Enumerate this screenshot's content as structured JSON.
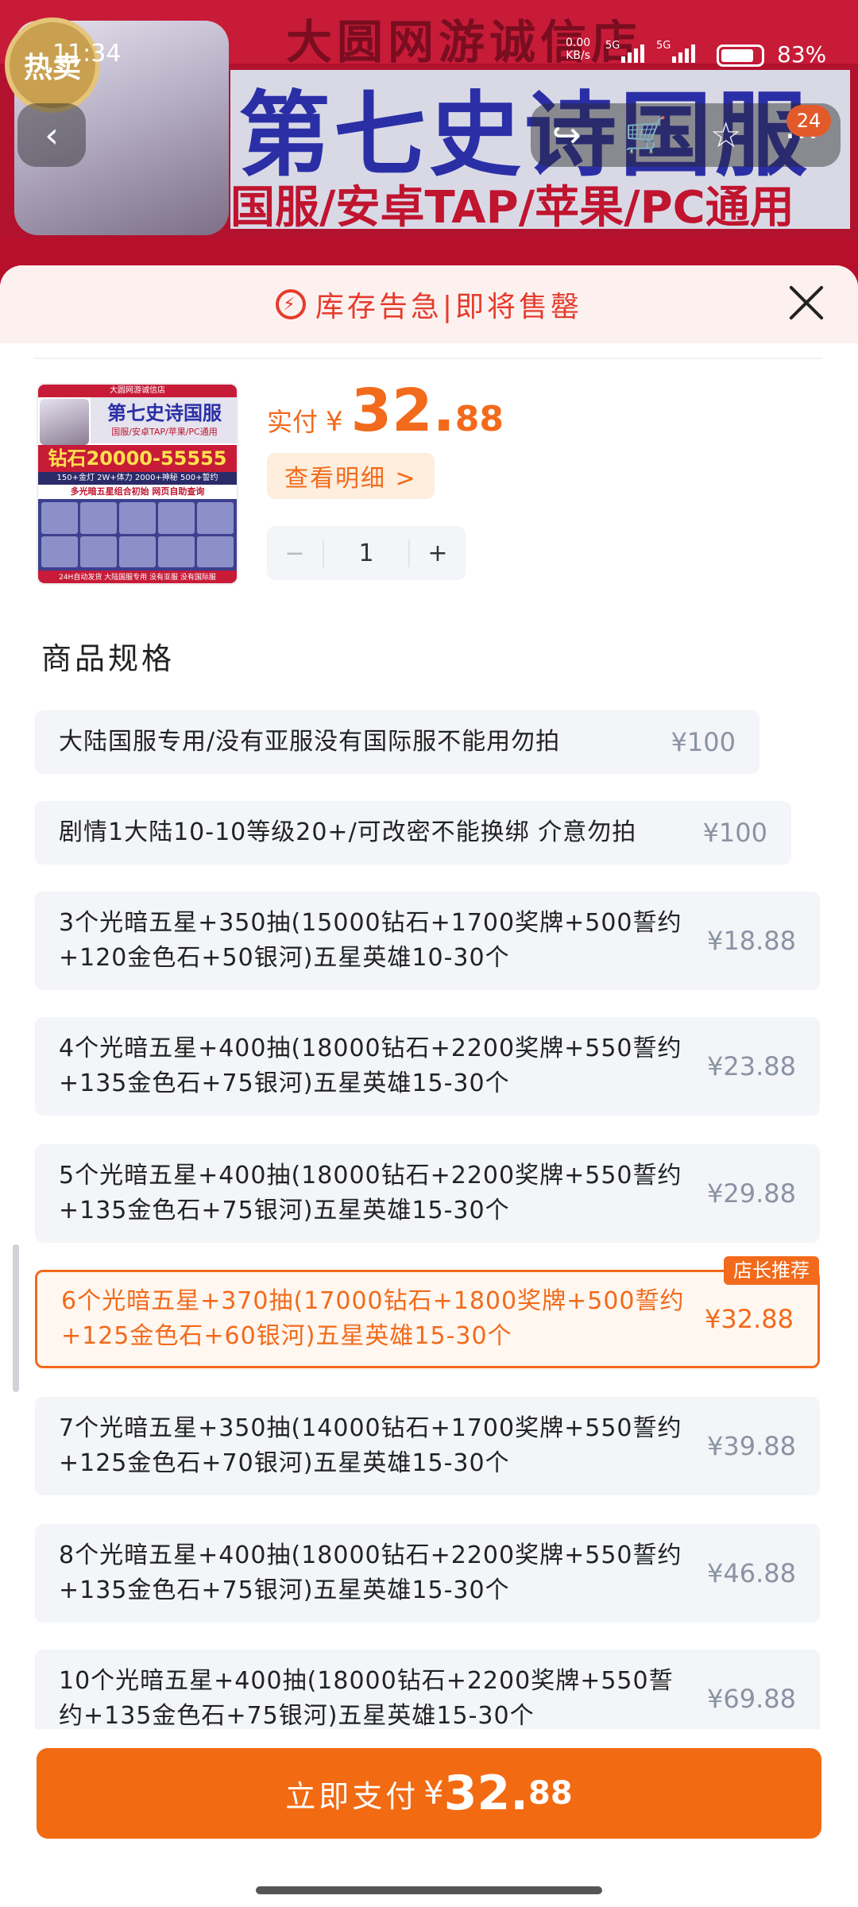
{
  "status_bar": {
    "time": "11:34",
    "net_speed": "0.00",
    "net_unit": "KB/s",
    "sim1": "5G",
    "sim2": "5G",
    "battery": "83"
  },
  "banner": {
    "shop_name": "大圆网游诚信店",
    "title": "第七史诗国服",
    "subtitle": "国服/安卓TAP/苹果/PC通用",
    "badge": "热卖",
    "cart_count": "24"
  },
  "sheet": {
    "alert_text": "库存告急|即将售罄",
    "close_label": "×"
  },
  "product": {
    "thumb": {
      "shop_name": "大圆网游诚信店",
      "title": "第七史诗国服",
      "subtitle": "国服/安卓TAP/苹果/PC通用",
      "diamonds": "钻石20000-55555",
      "line1": "150+金灯 2W+体力 2000+神秘 500+誓约",
      "line2": "多光暗五星组合初始 网页自助查询",
      "line3": "24H自动发货 大陆国服专用 没有亚服 没有国际服"
    },
    "price_label": "实付",
    "currency": "¥",
    "price_int": "32.",
    "price_dec": "88",
    "detail_label": "查看明细 >",
    "quantity": "1",
    "minus": "−",
    "plus": "+"
  },
  "specs_title": "商品规格",
  "options": [
    {
      "text": "大陆国服专用/没有亚服没有国际服不能用勿拍",
      "price": "¥100"
    },
    {
      "text": "剧情1大陆10-10等级20+/可改密不能换绑 介意勿拍",
      "price": "¥100"
    },
    {
      "text": "3个光暗五星+350抽(15000钻石+1700奖牌+500誓约+120金色石+50银河)五星英雄10-30个",
      "price": "¥18.88"
    },
    {
      "text": "4个光暗五星+400抽(18000钻石+2200奖牌+550誓约+135金色石+75银河)五星英雄15-30个",
      "price": "¥23.88"
    },
    {
      "text": "5个光暗五星+400抽(18000钻石+2200奖牌+550誓约+135金色石+75银河)五星英雄15-30个",
      "price": "¥29.88"
    },
    {
      "text": "6个光暗五星+370抽(17000钻石+1800奖牌+500誓约+125金色石+60银河)五星英雄15-30个",
      "price": "¥32.88",
      "badge": "店长推荐"
    },
    {
      "text": "7个光暗五星+350抽(14000钻石+1700奖牌+550誓约+125金色石+70银河)五星英雄15-30个",
      "price": "¥39.88"
    },
    {
      "text": "8个光暗五星+400抽(18000钻石+2200奖牌+550誓约+135金色石+75银河)五星英雄15-30个",
      "price": "¥46.88"
    },
    {
      "text": "10个光暗五星+400抽(18000钻石+2200奖牌+550誓约+135金色石+75银河)五星英雄15-30个",
      "price": "¥69.88"
    }
  ],
  "pay_button": {
    "label": "立即支付",
    "currency": "¥",
    "price_int": "32.",
    "price_dec": "88"
  },
  "colors": {
    "accent": "#f26a1b",
    "alert_red": "#e53b2c",
    "option_bg": "#f3f5f8"
  }
}
